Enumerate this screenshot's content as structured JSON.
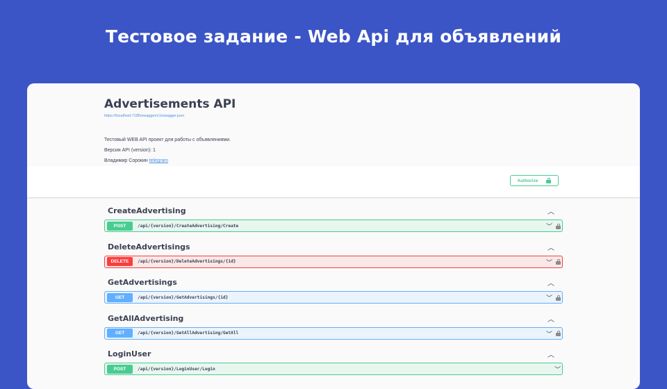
{
  "slide_title": "Тестовое задание - Web Api для объявлений",
  "info": {
    "title": "Advertisements API",
    "url": "https://localhost:7185/swagger/v1/swagger.json",
    "description": "Тестовый WEB API проект для работы с объявлениями.",
    "version": "Версия API (version): 1",
    "author": "Владимир Сорокин",
    "author_link": "telegram"
  },
  "authorize_label": "Authorize",
  "sections": [
    {
      "name": "CreateAdvertising",
      "method": "POST",
      "path": "/api/{version}/CreateAdvertising/Create"
    },
    {
      "name": "DeleteAdvertisings",
      "method": "DELETE",
      "path": "/api/{version}/DeleteAdvertisings/{id}"
    },
    {
      "name": "GetAdvertisings",
      "method": "GET",
      "path": "/api/{version}/GetAdvertisings/{id}"
    },
    {
      "name": "GetAllAdvertising",
      "method": "GET",
      "path": "/api/{version}/GetAllAdvertising/GetAll"
    },
    {
      "name": "LoginUser",
      "method": "POST",
      "path": "/api/{version}/LoginUser/Login"
    }
  ],
  "icons": {
    "expand": "chevron-up-icon",
    "collapse": "chevron-down-icon",
    "lock": "lock-icon"
  },
  "colors": {
    "background": "#3b55c6",
    "post": "#49cc90",
    "delete": "#f93e3e",
    "get": "#61affe"
  }
}
